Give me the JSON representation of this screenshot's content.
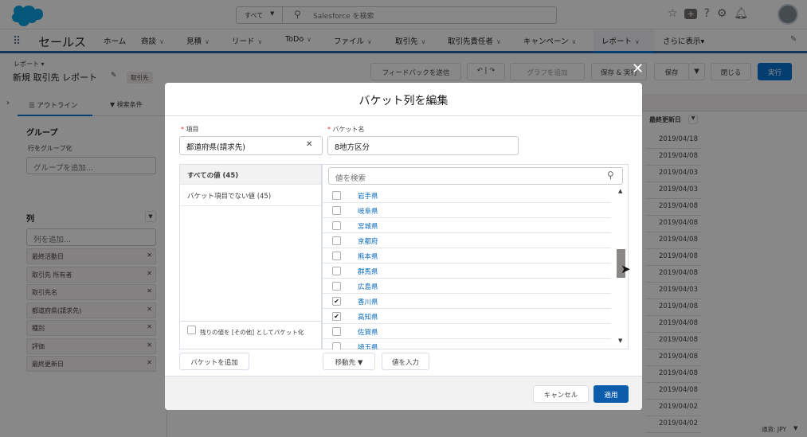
{
  "topbar": {
    "search_scope": "すべて",
    "search_placeholder": "Salesforce を検索"
  },
  "nav": {
    "app_name": "セールス",
    "items": [
      {
        "label": "ホーム",
        "dd": false
      },
      {
        "label": "商談",
        "dd": true
      },
      {
        "label": "見積",
        "dd": true
      },
      {
        "label": "リード",
        "dd": true
      },
      {
        "label": "ToDo",
        "dd": true
      },
      {
        "label": "ファイル",
        "dd": true
      },
      {
        "label": "取引先",
        "dd": true
      },
      {
        "label": "取引先責任者",
        "dd": true
      },
      {
        "label": "キャンペーン",
        "dd": true
      },
      {
        "label": "レポート",
        "dd": true
      },
      {
        "label": "さらに表示▾",
        "dd": false
      }
    ]
  },
  "header": {
    "object_type": "レポート ▾",
    "title": "新規 取引先 レポート",
    "badge": "取引先",
    "feedback_button": "フィードバックを送信",
    "chart_button": "グラフを追加",
    "save_run_button": "保存 & 実行",
    "save_button": "保存",
    "close_button": "閉じる",
    "run_button": "実行"
  },
  "left_panel": {
    "outline_tab": "アウトライン",
    "filter_tab": "検索条件",
    "group_title": "グループ",
    "group_hint": "行をグループ化",
    "group_placeholder": "グループを追加...",
    "columns_title": "列",
    "column_placeholder": "列を追加...",
    "columns": [
      "最終活動日",
      "取引先 所有者",
      "取引先名",
      "都道府県(請求先)",
      "種別",
      "評価",
      "最終更新日"
    ]
  },
  "table": {
    "col_header": "最終更新日",
    "dates": [
      "2019/04/18",
      "2019/04/08",
      "2019/04/03",
      "2019/04/03",
      "2019/04/08",
      "2019/04/08",
      "2019/04/08",
      "2019/04/08",
      "2019/04/08",
      "2019/04/03",
      "2019/04/08",
      "2019/04/08",
      "2019/04/08",
      "2019/04/08",
      "2019/04/08",
      "2019/04/08",
      "2019/04/02",
      "2019/04/02"
    ],
    "currency": "通貨: JPY"
  },
  "modal": {
    "title": "バケット列を編集",
    "field_label": "項目",
    "field_value": "都道府県(請求先)",
    "bucket_label": "バケット名",
    "bucket_value": "8地方区分",
    "all_values": "すべての値 (45)",
    "unbucketed": "バケット項目でない値 (45)",
    "other_bucket_text": "残りの値を [その他] としてバケット化",
    "value_search_placeholder": "値を検索",
    "values": [
      {
        "label": "岩手県",
        "checked": false
      },
      {
        "label": "岐阜県",
        "checked": false
      },
      {
        "label": "宮城県",
        "checked": false
      },
      {
        "label": "京都府",
        "checked": false
      },
      {
        "label": "熊本県",
        "checked": false
      },
      {
        "label": "群馬県",
        "checked": false
      },
      {
        "label": "広島県",
        "checked": false
      },
      {
        "label": "香川県",
        "checked": true
      },
      {
        "label": "高知県",
        "checked": true
      },
      {
        "label": "佐賀県",
        "checked": false
      },
      {
        "label": "埼玉県",
        "checked": false
      }
    ],
    "add_bucket_button": "バケットを追加",
    "move_to_button": "移動先",
    "enter_value_button": "値を入力",
    "cancel_button": "キャンセル",
    "apply_button": "適用"
  },
  "colors": {
    "brand": "#0070d2",
    "nav_border": "#1b5fa3",
    "apply": "#0b5cab",
    "link": "#0b6bbd"
  }
}
